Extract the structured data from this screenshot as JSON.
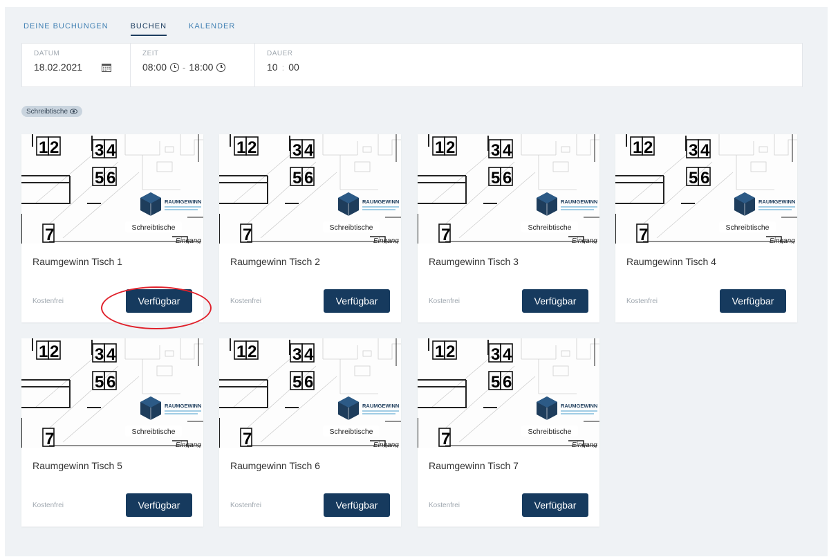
{
  "tabs": [
    {
      "label": "DEINE BUCHUNGEN",
      "active": false
    },
    {
      "label": "BUCHEN",
      "active": true
    },
    {
      "label": "KALENDER",
      "active": false
    }
  ],
  "filter": {
    "date": {
      "label": "DATUM",
      "value": "18.02.2021",
      "icon": "calendar-icon"
    },
    "time": {
      "label": "ZEIT",
      "start": "08:00",
      "separator": "-",
      "end": "18:00",
      "icon": "clock-icon"
    },
    "duration": {
      "label": "DAUER",
      "hours": "10",
      "separator": ":",
      "minutes": "00"
    }
  },
  "chip": {
    "label": "Schreibtische",
    "icon": "eye-icon"
  },
  "floorplan": {
    "desk_labels": [
      "1",
      "2",
      "3",
      "4",
      "5",
      "6",
      "7"
    ],
    "logo_text": "RAUMGEWINN",
    "overlay_label": "Schreibtische",
    "entrance_label": "Eingang"
  },
  "cards": [
    {
      "title": "Raumgewinn Tisch 1",
      "price": "Kostenfrei",
      "button": "Verfügbar",
      "highlighted": true
    },
    {
      "title": "Raumgewinn Tisch 2",
      "price": "Kostenfrei",
      "button": "Verfügbar",
      "highlighted": false
    },
    {
      "title": "Raumgewinn Tisch 3",
      "price": "Kostenfrei",
      "button": "Verfügbar",
      "highlighted": false
    },
    {
      "title": "Raumgewinn Tisch 4",
      "price": "Kostenfrei",
      "button": "Verfügbar",
      "highlighted": false
    },
    {
      "title": "Raumgewinn Tisch 5",
      "price": "Kostenfrei",
      "button": "Verfügbar",
      "highlighted": false
    },
    {
      "title": "Raumgewinn Tisch 6",
      "price": "Kostenfrei",
      "button": "Verfügbar",
      "highlighted": false
    },
    {
      "title": "Raumgewinn Tisch 7",
      "price": "Kostenfrei",
      "button": "Verfügbar",
      "highlighted": false
    }
  ],
  "colors": {
    "primary": "#163a5e",
    "tab": "#3f7fb2",
    "highlight": "#e0212b",
    "background": "#eff2f5"
  }
}
